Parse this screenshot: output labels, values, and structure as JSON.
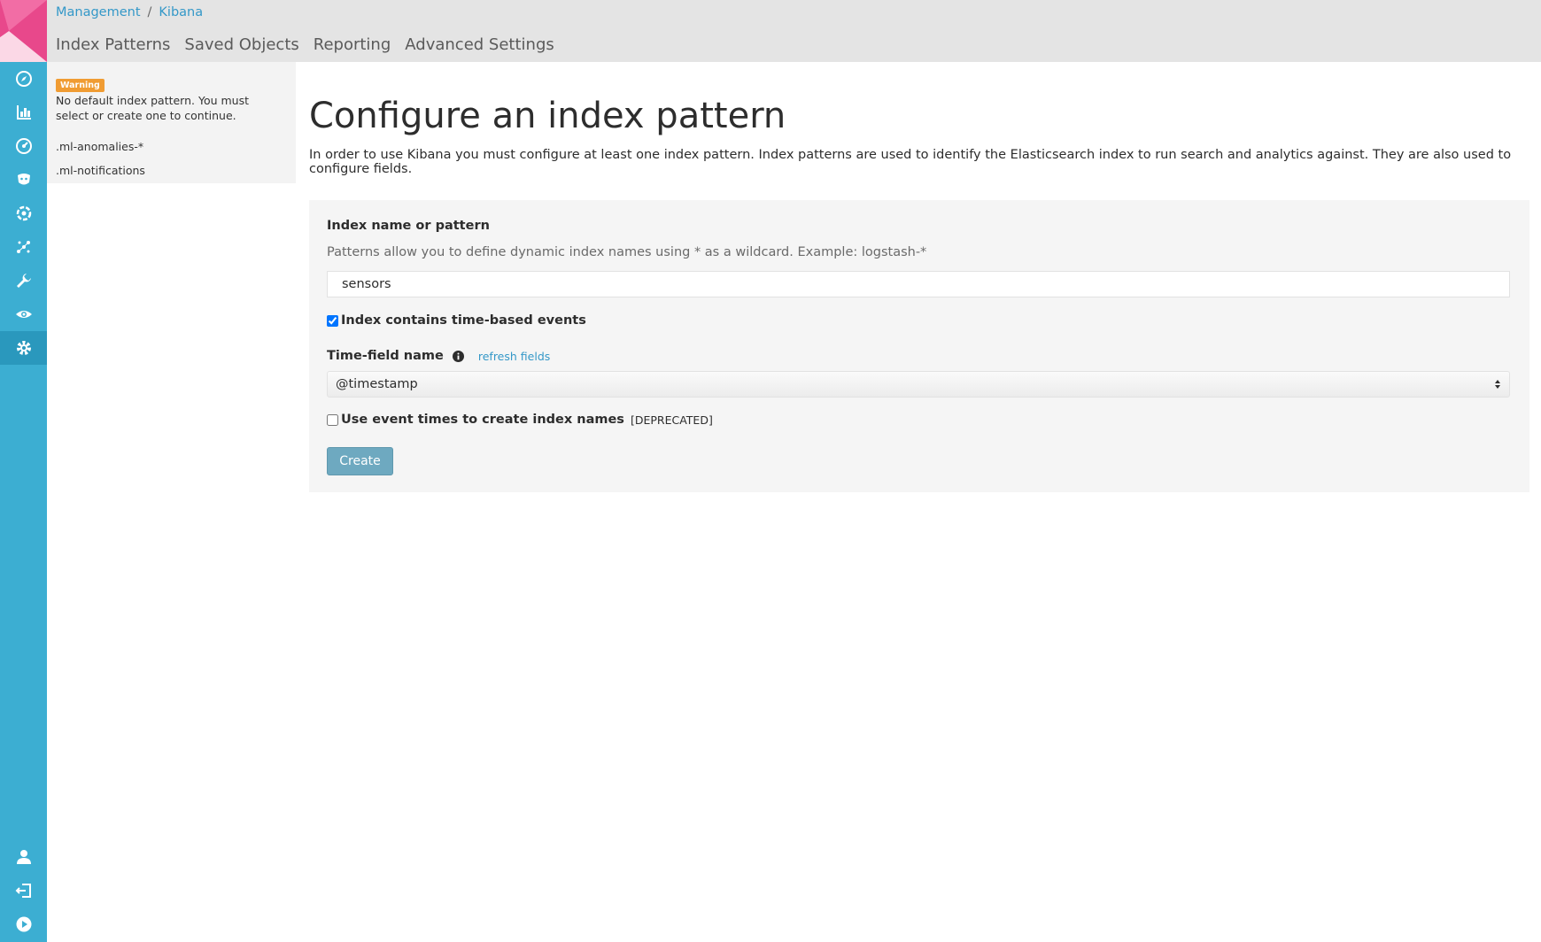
{
  "breadcrumb": {
    "parent": "Management",
    "separator": "/",
    "current": "Kibana"
  },
  "tabs": [
    {
      "label": "Index Patterns"
    },
    {
      "label": "Saved Objects"
    },
    {
      "label": "Reporting"
    },
    {
      "label": "Advanced Settings"
    }
  ],
  "nav": {
    "icons": [
      "discover-icon",
      "visualize-icon",
      "dashboard-icon",
      "timelion-icon",
      "machine-learning-icon",
      "graph-icon",
      "dev-tools-icon",
      "monitoring-icon",
      "management-icon"
    ],
    "active": "management-icon",
    "bottom_icons": [
      "user-icon",
      "logout-icon",
      "collapse-icon"
    ],
    "color": "#3caed2",
    "logo_color": "#e8488b"
  },
  "sidebar": {
    "warning_badge": "Warning",
    "warning_text": "No default index pattern. You must select or create one to continue.",
    "index_patterns": [
      ".ml-anomalies-*",
      ".ml-notifications"
    ]
  },
  "main": {
    "title": "Configure an index pattern",
    "description": "In order to use Kibana you must configure at least one index pattern. Index patterns are used to identify the Elasticsearch index to run search and analytics against. They are also used to configure fields.",
    "form": {
      "index_label": "Index name or pattern",
      "index_help": "Patterns allow you to define dynamic index names using * as a wildcard. Example: logstash-*",
      "index_value": "sensors",
      "time_based_label": "Index contains time-based events",
      "time_based_checked": true,
      "time_field_label": "Time-field name",
      "refresh_fields": "refresh fields",
      "time_field_value": "@timestamp",
      "event_times_label": "Use event times to create index names",
      "event_times_deprecated": "[DEPRECATED]",
      "event_times_checked": false,
      "create_button": "Create"
    }
  }
}
